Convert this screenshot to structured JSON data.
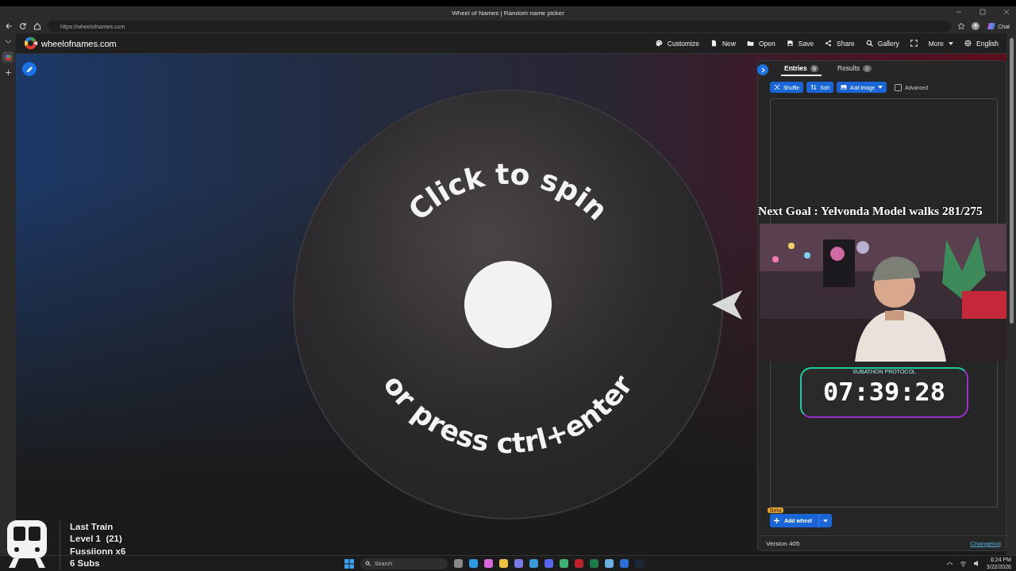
{
  "browser": {
    "tab_title": "Wheel of Names | Random name picker",
    "url": "https://wheelofnames.com",
    "chat": "Chat"
  },
  "site": {
    "logo_text": "wheelofnames.com",
    "menu": [
      {
        "label": "Customize",
        "dropdown": false
      },
      {
        "label": "New",
        "dropdown": false
      },
      {
        "label": "Open",
        "dropdown": false
      },
      {
        "label": "Save",
        "dropdown": false
      },
      {
        "label": "Share",
        "dropdown": false
      },
      {
        "label": "Gallery",
        "dropdown": false
      },
      {
        "kind": "fullscreen",
        "dropdown": false
      },
      {
        "label": "More",
        "dropdown": true
      },
      {
        "label": "English",
        "dropdown": false
      }
    ]
  },
  "wheel": {
    "top_text": "Click to spin",
    "bottom_text": "or press ctrl+enter"
  },
  "panel": {
    "tabs": [
      {
        "label": "Entries",
        "count": "0",
        "selected": true
      },
      {
        "label": "Results",
        "count": "0",
        "selected": false
      }
    ],
    "buttons": [
      {
        "label": "Shuffle",
        "dropdown": false
      },
      {
        "label": "Sort",
        "dropdown": false
      },
      {
        "label": "Add image",
        "dropdown": true
      }
    ],
    "advanced": {
      "label": "Advanced",
      "checked": false
    },
    "add_wheel": {
      "label": "Add wheel",
      "badge": "Beta"
    },
    "version": "Version 405",
    "changelog": "Changelog"
  },
  "overlay": {
    "goal": "Next Goal : Yelvonda Model walks 281/275",
    "timer_caption": "SUBATHON PROTOCOL",
    "timer": "07:39:28",
    "train": [
      "Last Train",
      "Level 1  (21)",
      "Fussiionn x6",
      "6 Subs"
    ]
  },
  "taskbar": {
    "search": "Search",
    "time": "6:24 PM",
    "date": "3/22/2026"
  }
}
